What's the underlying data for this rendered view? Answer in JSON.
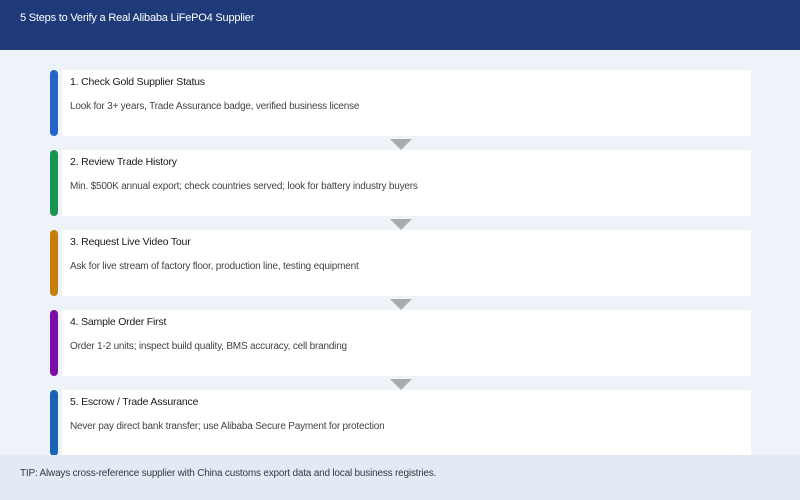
{
  "header": {
    "title": "5 Steps to Verify a Real Alibaba LiFePO4 Supplier"
  },
  "steps": [
    {
      "title": "1. Check Gold Supplier Status",
      "description": "Look for 3+ years, Trade Assurance badge, verified business license",
      "color": "#2563c9"
    },
    {
      "title": "2. Review Trade History",
      "description": "Min. $500K annual export; check countries served; look for battery industry buyers",
      "color": "#1a9450"
    },
    {
      "title": "3. Request Live Video Tour",
      "description": "Ask for live stream of factory floor, production line, testing equipment",
      "color": "#c57e0b"
    },
    {
      "title": "4. Sample Order First",
      "description": "Order 1-2 units; inspect build quality, BMS accuracy, cell branding",
      "color": "#7a0fa8"
    },
    {
      "title": "5. Escrow / Trade Assurance",
      "description": "Never pay direct bank transfer; use Alibaba Secure Payment for protection",
      "color": "#1b63b5"
    }
  ],
  "tip": {
    "text": "TIP: Always cross-reference supplier with China customs export data and local business registries."
  }
}
